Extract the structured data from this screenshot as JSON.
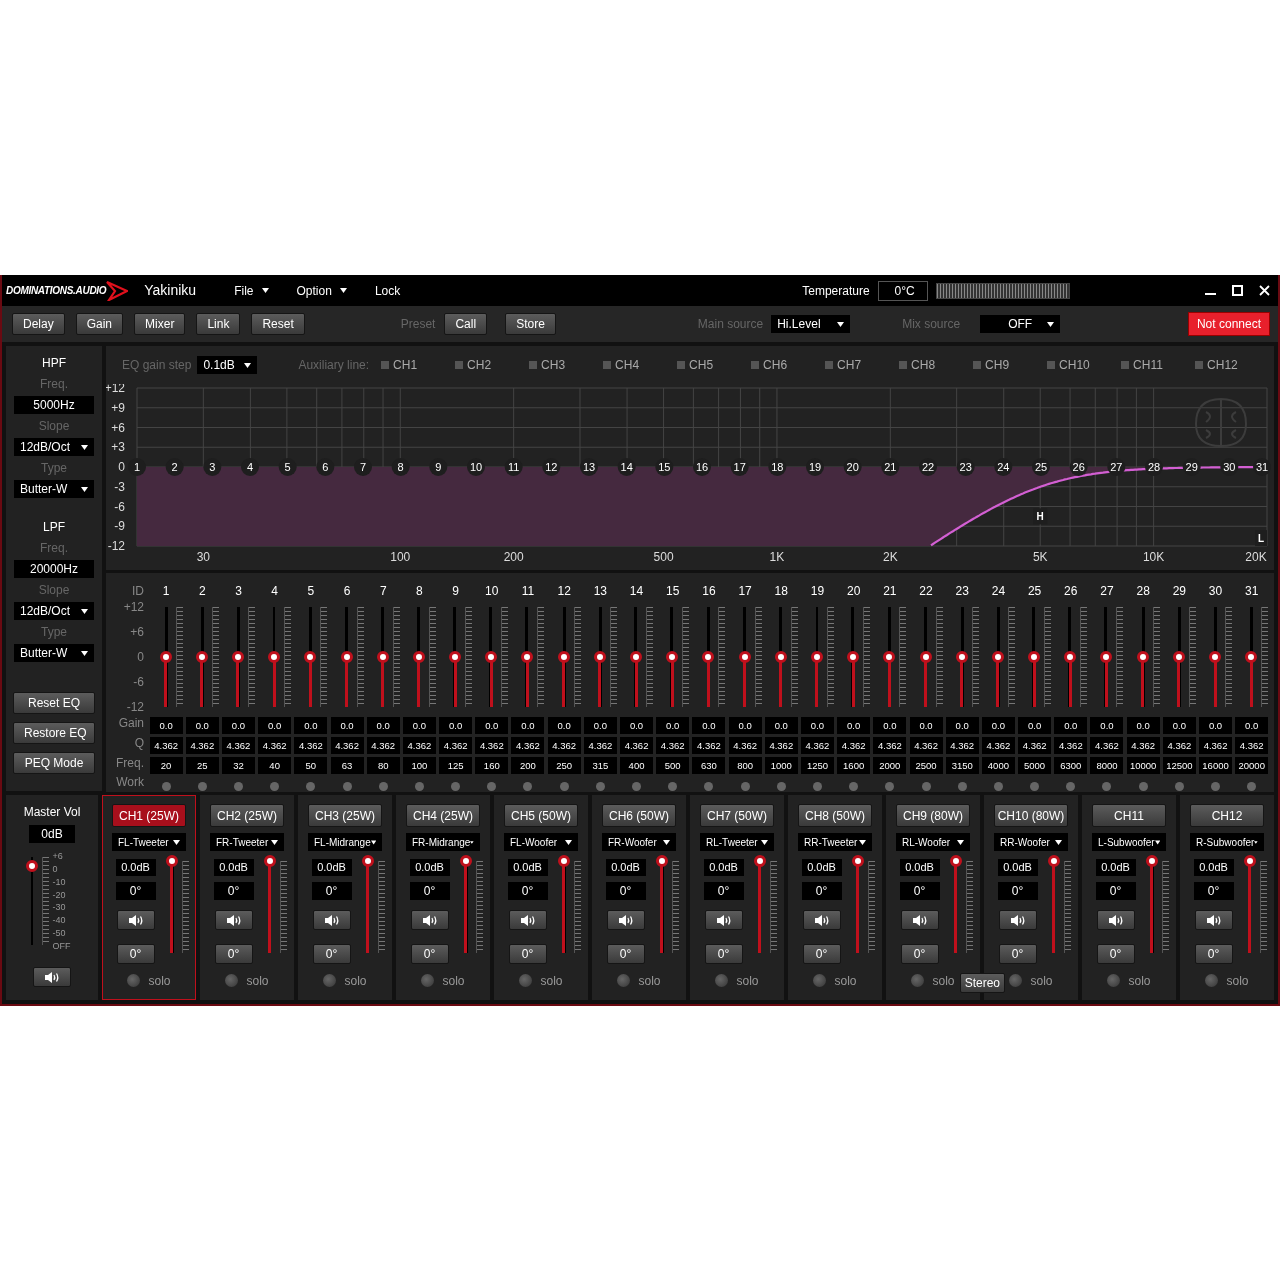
{
  "window": {
    "logo": "DOMINATIONS.AUDIO",
    "title": "Yakiniku",
    "menus": [
      {
        "label": "File",
        "caret": true
      },
      {
        "label": "Option",
        "caret": true
      },
      {
        "label": "Lock",
        "caret": false
      }
    ],
    "temperature_label": "Temperature",
    "temperature": "0°C"
  },
  "toolbar": {
    "buttons": [
      "Delay",
      "Gain",
      "Mixer",
      "Link",
      "Reset"
    ],
    "preset_label": "Preset",
    "preset_buttons": [
      "Call",
      "Store"
    ],
    "main_source_label": "Main source",
    "main_source": "Hi.Level",
    "mix_source_label": "Mix source",
    "mix_source": "OFF",
    "connection": "Not connect"
  },
  "filters": [
    {
      "title": "HPF",
      "freq_label": "Freq.",
      "freq": "5000Hz",
      "slope_label": "Slope",
      "slope": "12dB/Oct",
      "type_label": "Type",
      "type": "Butter-W"
    },
    {
      "title": "LPF",
      "freq_label": "Freq.",
      "freq": "20000Hz",
      "slope_label": "Slope",
      "slope": "12dB/Oct",
      "type_label": "Type",
      "type": "Butter-W"
    }
  ],
  "eq_buttons": [
    "Reset EQ",
    "Restore EQ",
    "PEQ Mode"
  ],
  "graph": {
    "gain_step_label": "EQ gain step",
    "gain_step": "0.1dB",
    "aux_label": "Auxiliary line:",
    "aux_lines": [
      {
        "label": "CH1",
        "checked": false
      },
      {
        "label": "CH2",
        "checked": false
      },
      {
        "label": "CH3",
        "checked": false
      },
      {
        "label": "CH4",
        "checked": false
      },
      {
        "label": "CH5",
        "checked": false
      },
      {
        "label": "CH6",
        "checked": false
      },
      {
        "label": "CH7",
        "checked": false
      },
      {
        "label": "CH8",
        "checked": false
      },
      {
        "label": "CH9",
        "checked": false
      },
      {
        "label": "CH10",
        "checked": false
      },
      {
        "label": "CH11",
        "checked": false
      },
      {
        "label": "CH12",
        "checked": false
      }
    ],
    "y_labels": [
      "+12",
      "+9",
      "+6",
      "+3",
      "0",
      "-3",
      "-6",
      "-9",
      "-12"
    ],
    "x_labels": [
      "30",
      "100",
      "200",
      "500",
      "1K",
      "2K",
      "5K",
      "10K",
      "20K"
    ],
    "band_markers": [
      "1",
      "2",
      "3",
      "4",
      "5",
      "6",
      "7",
      "8",
      "9",
      "10",
      "11",
      "12",
      "13",
      "14",
      "15",
      "16",
      "17",
      "18",
      "19",
      "20",
      "21",
      "22",
      "23",
      "24",
      "25",
      "26",
      "27",
      "28",
      "29",
      "30",
      "31"
    ],
    "hpf_marker": "H",
    "lpf_marker": "L"
  },
  "band_labels": {
    "id": "ID",
    "scale": [
      "+12",
      "+6",
      "0",
      "-6",
      "-12"
    ],
    "gain": "Gain",
    "q": "Q",
    "freq": "Freq.",
    "work": "Work"
  },
  "bands": [
    {
      "id": "1",
      "gain": "0.0",
      "q": "4.362",
      "freq": "20",
      "level": 0.5,
      "work": false
    },
    {
      "id": "2",
      "gain": "0.0",
      "q": "4.362",
      "freq": "25",
      "level": 0.5,
      "work": false
    },
    {
      "id": "3",
      "gain": "0.0",
      "q": "4.362",
      "freq": "32",
      "level": 0.5,
      "work": false
    },
    {
      "id": "4",
      "gain": "0.0",
      "q": "4.362",
      "freq": "40",
      "level": 0.5,
      "work": false
    },
    {
      "id": "5",
      "gain": "0.0",
      "q": "4.362",
      "freq": "50",
      "level": 0.5,
      "work": false
    },
    {
      "id": "6",
      "gain": "0.0",
      "q": "4.362",
      "freq": "63",
      "level": 0.5,
      "work": false
    },
    {
      "id": "7",
      "gain": "0.0",
      "q": "4.362",
      "freq": "80",
      "level": 0.5,
      "work": false
    },
    {
      "id": "8",
      "gain": "0.0",
      "q": "4.362",
      "freq": "100",
      "level": 0.5,
      "work": false
    },
    {
      "id": "9",
      "gain": "0.0",
      "q": "4.362",
      "freq": "125",
      "level": 0.5,
      "work": false
    },
    {
      "id": "10",
      "gain": "0.0",
      "q": "4.362",
      "freq": "160",
      "level": 0.5,
      "work": false
    },
    {
      "id": "11",
      "gain": "0.0",
      "q": "4.362",
      "freq": "200",
      "level": 0.5,
      "work": false
    },
    {
      "id": "12",
      "gain": "0.0",
      "q": "4.362",
      "freq": "250",
      "level": 0.5,
      "work": false
    },
    {
      "id": "13",
      "gain": "0.0",
      "q": "4.362",
      "freq": "315",
      "level": 0.5,
      "work": false
    },
    {
      "id": "14",
      "gain": "0.0",
      "q": "4.362",
      "freq": "400",
      "level": 0.5,
      "work": false
    },
    {
      "id": "15",
      "gain": "0.0",
      "q": "4.362",
      "freq": "500",
      "level": 0.5,
      "work": false
    },
    {
      "id": "16",
      "gain": "0.0",
      "q": "4.362",
      "freq": "630",
      "level": 0.5,
      "work": false
    },
    {
      "id": "17",
      "gain": "0.0",
      "q": "4.362",
      "freq": "800",
      "level": 0.5,
      "work": false
    },
    {
      "id": "18",
      "gain": "0.0",
      "q": "4.362",
      "freq": "1000",
      "level": 0.5,
      "work": false
    },
    {
      "id": "19",
      "gain": "0.0",
      "q": "4.362",
      "freq": "1250",
      "level": 0.5,
      "work": false
    },
    {
      "id": "20",
      "gain": "0.0",
      "q": "4.362",
      "freq": "1600",
      "level": 0.5,
      "work": false
    },
    {
      "id": "21",
      "gain": "0.0",
      "q": "4.362",
      "freq": "2000",
      "level": 0.5,
      "work": false
    },
    {
      "id": "22",
      "gain": "0.0",
      "q": "4.362",
      "freq": "2500",
      "level": 0.5,
      "work": false
    },
    {
      "id": "23",
      "gain": "0.0",
      "q": "4.362",
      "freq": "3150",
      "level": 0.5,
      "work": false
    },
    {
      "id": "24",
      "gain": "0.0",
      "q": "4.362",
      "freq": "4000",
      "level": 0.5,
      "work": false
    },
    {
      "id": "25",
      "gain": "0.0",
      "q": "4.362",
      "freq": "5000",
      "level": 0.5,
      "work": false
    },
    {
      "id": "26",
      "gain": "0.0",
      "q": "4.362",
      "freq": "6300",
      "level": 0.5,
      "work": false
    },
    {
      "id": "27",
      "gain": "0.0",
      "q": "4.362",
      "freq": "8000",
      "level": 0.5,
      "work": false
    },
    {
      "id": "28",
      "gain": "0.0",
      "q": "4.362",
      "freq": "10000",
      "level": 0.5,
      "work": false
    },
    {
      "id": "29",
      "gain": "0.0",
      "q": "4.362",
      "freq": "12500",
      "level": 0.5,
      "work": false
    },
    {
      "id": "30",
      "gain": "0.0",
      "q": "4.362",
      "freq": "16000",
      "level": 0.5,
      "work": false
    },
    {
      "id": "31",
      "gain": "0.0",
      "q": "4.362",
      "freq": "20000",
      "level": 0.5,
      "work": false
    }
  ],
  "master": {
    "label": "Master Vol",
    "value": "0dB",
    "scale": [
      "+6",
      "0",
      "-10",
      "-20",
      "-30",
      "-40",
      "-50",
      "OFF"
    ],
    "level": 0.9
  },
  "channels": [
    {
      "name": "CH1 (25W)",
      "selected": true,
      "position": "FL-Tweeter",
      "gain": "0.0dB",
      "phase": "0°",
      "phase_button": "0°",
      "level": 1,
      "solo_label": "solo",
      "solo": false
    },
    {
      "name": "CH2 (25W)",
      "selected": false,
      "position": "FR-Tweeter",
      "gain": "0.0dB",
      "phase": "0°",
      "phase_button": "0°",
      "level": 1,
      "solo_label": "solo",
      "solo": false
    },
    {
      "name": "CH3 (25W)",
      "selected": false,
      "position": "FL-Midrange",
      "gain": "0.0dB",
      "phase": "0°",
      "phase_button": "0°",
      "level": 1,
      "solo_label": "solo",
      "solo": false
    },
    {
      "name": "CH4 (25W)",
      "selected": false,
      "position": "FR-Midrange",
      "gain": "0.0dB",
      "phase": "0°",
      "phase_button": "0°",
      "level": 1,
      "solo_label": "solo",
      "solo": false
    },
    {
      "name": "CH5 (50W)",
      "selected": false,
      "position": "FL-Woofer",
      "gain": "0.0dB",
      "phase": "0°",
      "phase_button": "0°",
      "level": 1,
      "solo_label": "solo",
      "solo": false
    },
    {
      "name": "CH6 (50W)",
      "selected": false,
      "position": "FR-Woofer",
      "gain": "0.0dB",
      "phase": "0°",
      "phase_button": "0°",
      "level": 1,
      "solo_label": "solo",
      "solo": false
    },
    {
      "name": "CH7 (50W)",
      "selected": false,
      "position": "RL-Tweeter",
      "gain": "0.0dB",
      "phase": "0°",
      "phase_button": "0°",
      "level": 1,
      "solo_label": "solo",
      "solo": false
    },
    {
      "name": "CH8 (50W)",
      "selected": false,
      "position": "RR-Tweeter",
      "gain": "0.0dB",
      "phase": "0°",
      "phase_button": "0°",
      "level": 1,
      "solo_label": "solo",
      "solo": false
    },
    {
      "name": "CH9 (80W)",
      "selected": false,
      "position": "RL-Woofer",
      "gain": "0.0dB",
      "phase": "0°",
      "phase_button": "0°",
      "level": 1,
      "solo_label": "solo",
      "solo": false,
      "link": "Stereo"
    },
    {
      "name": "CH10 (80W)",
      "selected": false,
      "position": "RR-Woofer",
      "gain": "0.0dB",
      "phase": "0°",
      "phase_button": "0°",
      "level": 1,
      "solo_label": "solo",
      "solo": false
    },
    {
      "name": "CH11",
      "selected": false,
      "position": "L-Subwoofer",
      "gain": "0.0dB",
      "phase": "0°",
      "phase_button": "0°",
      "level": 1,
      "solo_label": "solo",
      "solo": false
    },
    {
      "name": "CH12",
      "selected": false,
      "position": "R-Subwoofer",
      "gain": "0.0dB",
      "phase": "0°",
      "phase_button": "0°",
      "level": 1,
      "solo_label": "solo",
      "solo": false
    }
  ]
}
